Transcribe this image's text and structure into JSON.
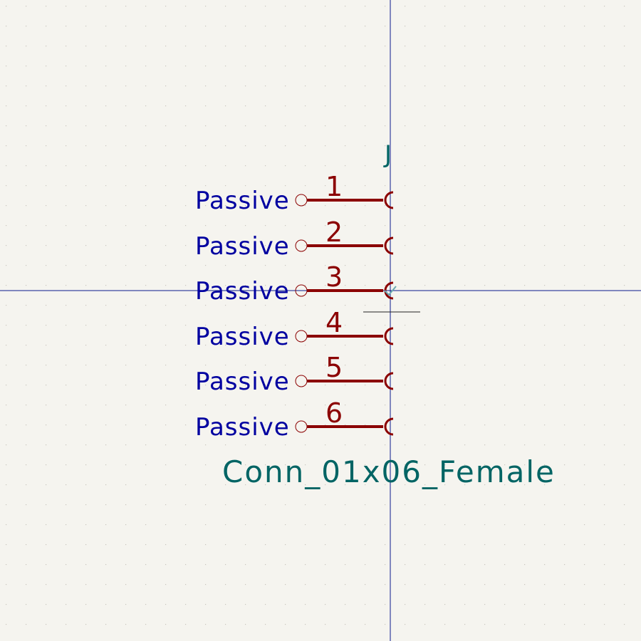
{
  "symbol": {
    "reference": "J",
    "value": "Conn_01x06_Female",
    "pins": [
      {
        "number": "1",
        "type": "Passive"
      },
      {
        "number": "2",
        "type": "Passive"
      },
      {
        "number": "3",
        "type": "Passive"
      },
      {
        "number": "4",
        "type": "Passive"
      },
      {
        "number": "5",
        "type": "Passive"
      },
      {
        "number": "6",
        "type": "Passive"
      }
    ]
  },
  "colors": {
    "background": "#f5f4ef",
    "grid_dot": "#c8c6bd",
    "axis_line": "#0a1a8c",
    "pin_body": "#8b0000",
    "pin_type_text": "#0000a0",
    "field_text": "#006464",
    "anchor": "#6aa8b0"
  }
}
